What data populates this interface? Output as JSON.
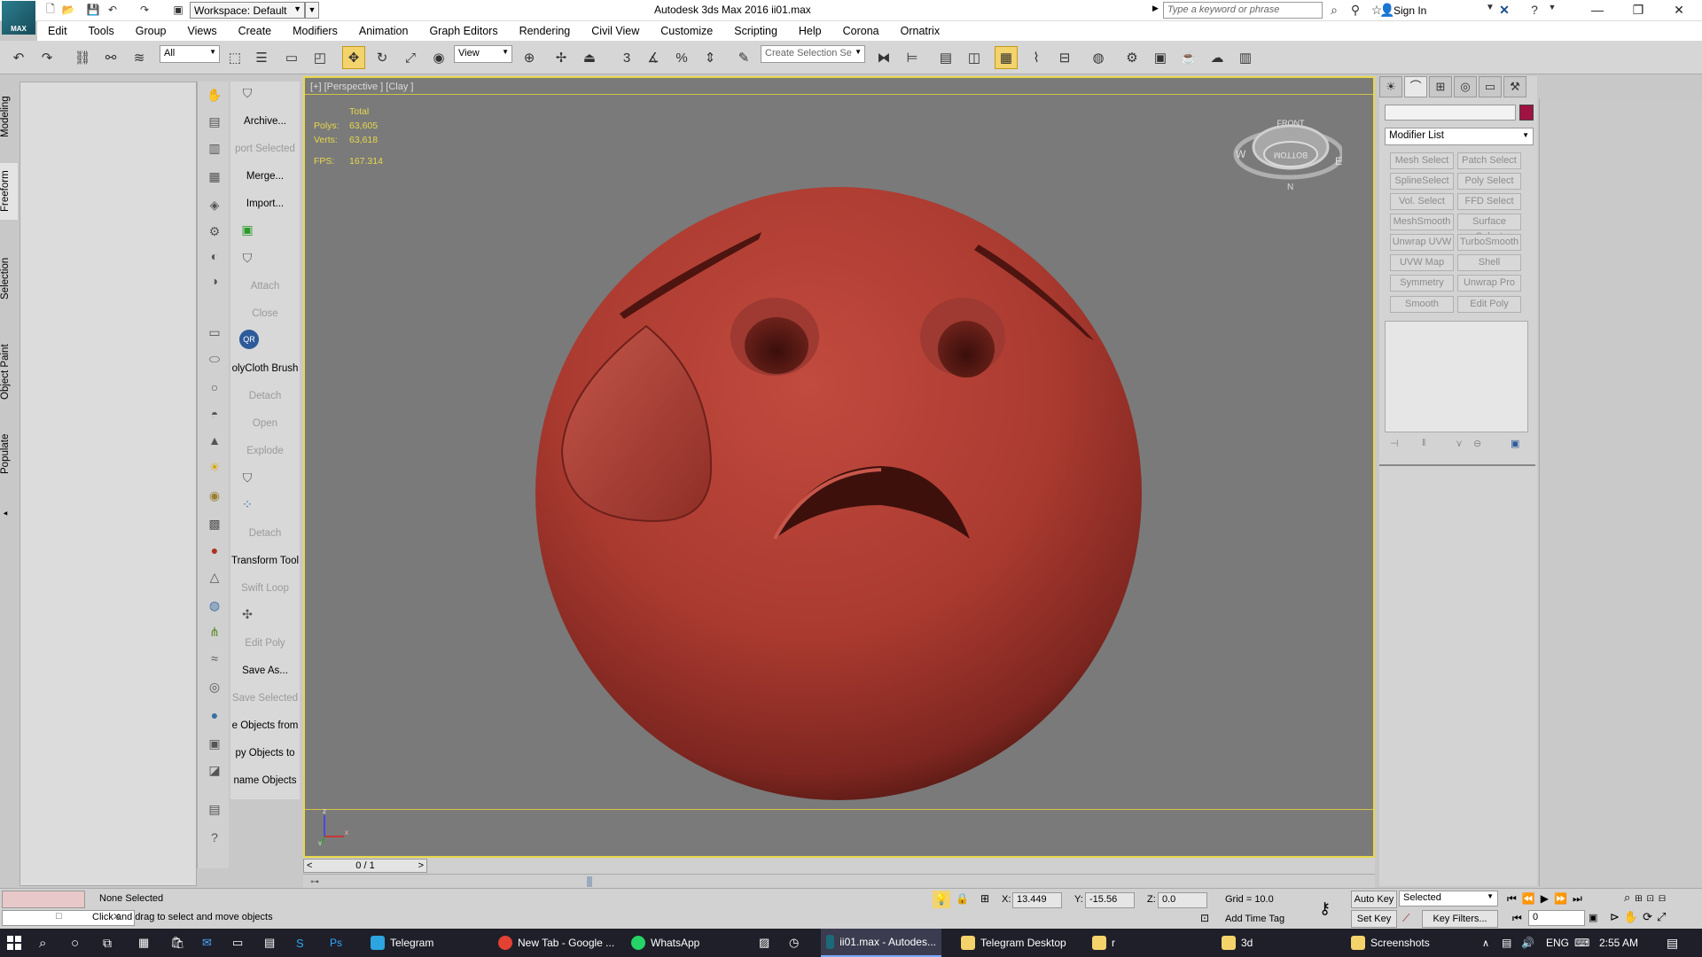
{
  "app": {
    "logo_text": "MAX",
    "title": "Autodesk 3ds Max 2016     ii01.max",
    "workspace": "Workspace: Default",
    "search_placeholder": "Type a keyword or phrase",
    "sign_in": "Sign In"
  },
  "menu": [
    "Edit",
    "Tools",
    "Group",
    "Views",
    "Create",
    "Modifiers",
    "Animation",
    "Graph Editors",
    "Rendering",
    "Civil View",
    "Customize",
    "Scripting",
    "Help",
    "Corona",
    "Ornatrix"
  ],
  "toolbar": {
    "filter": "All",
    "ref_coord": "View",
    "selection_set_placeholder": "Create Selection Se"
  },
  "side_tabs": [
    "Modeling",
    "Freeform",
    "Selection",
    "Object Paint",
    "Populate"
  ],
  "tools_labels": [
    {
      "label": "Archive...",
      "dim": false
    },
    {
      "label": "port Selected",
      "dim": true
    },
    {
      "label": "Merge...",
      "dim": false
    },
    {
      "label": "Import...",
      "dim": false
    },
    {
      "label": "Attach",
      "dim": true
    },
    {
      "label": "Close",
      "dim": true
    },
    {
      "label": "olyCloth Brush",
      "dim": false
    },
    {
      "label": "Detach",
      "dim": true
    },
    {
      "label": "Open",
      "dim": true
    },
    {
      "label": "Explode",
      "dim": true
    },
    {
      "label": "Detach",
      "dim": true
    },
    {
      "label": "Transform Tool",
      "dim": false
    },
    {
      "label": "Swift Loop",
      "dim": true
    },
    {
      "label": "Edit Poly",
      "dim": true
    },
    {
      "label": "Save As...",
      "dim": false
    },
    {
      "label": "Save Selected",
      "dim": true
    },
    {
      "label": "e Objects from",
      "dim": false
    },
    {
      "label": "py Objects to",
      "dim": false
    },
    {
      "label": "name Objects",
      "dim": false
    }
  ],
  "viewport": {
    "label": "[+] [Perspective ] [Clay ]",
    "stats_header": "Total",
    "polys_label": "Polys:",
    "polys": "63,605",
    "verts_label": "Verts:",
    "verts": "63,618",
    "fps_label": "FPS:",
    "fps": "167.314",
    "viewcube_top": "FRONT",
    "viewcube_face": "BOTTOM",
    "object_color": "#b8443a"
  },
  "timeline": {
    "frame": "0 / 1"
  },
  "command_panel": {
    "modifier_list": "Modifier List",
    "object_color": "#9e1341",
    "modifiers": [
      [
        "Mesh Select",
        "Patch Select"
      ],
      [
        "SplineSelect",
        "Poly Select"
      ],
      [
        "Vol. Select",
        "FFD Select"
      ],
      [
        "MeshSmooth",
        "Surface Select"
      ],
      [
        "Unwrap UVW",
        "TurboSmooth"
      ],
      [
        "UVW Map",
        "Shell"
      ],
      [
        "Symmetry",
        "Unwrap Pro"
      ],
      [
        "Smooth",
        "Edit Poly"
      ]
    ]
  },
  "status": {
    "selection": "None Selected",
    "prompt": "Click and drag to select and move objects",
    "x_label": "X:",
    "x": "13.449",
    "y_label": "Y:",
    "y": "-15.56",
    "z_label": "Z:",
    "z": "0.0",
    "grid": "Grid = 10.0",
    "add_time_tag": "Add Time Tag",
    "auto_key": "Auto Key",
    "set_key": "Set Key",
    "selected": "Selected",
    "key_filters": "Key Filters...",
    "frame_field": "0"
  },
  "taskbar": {
    "items": [
      "Telegram",
      "New Tab - Google ...",
      "WhatsApp",
      "ii01.max - Autodes...",
      "Telegram Desktop",
      "r",
      "3d",
      "Screenshots"
    ],
    "lang": "ENG",
    "time": "2:55 AM"
  }
}
